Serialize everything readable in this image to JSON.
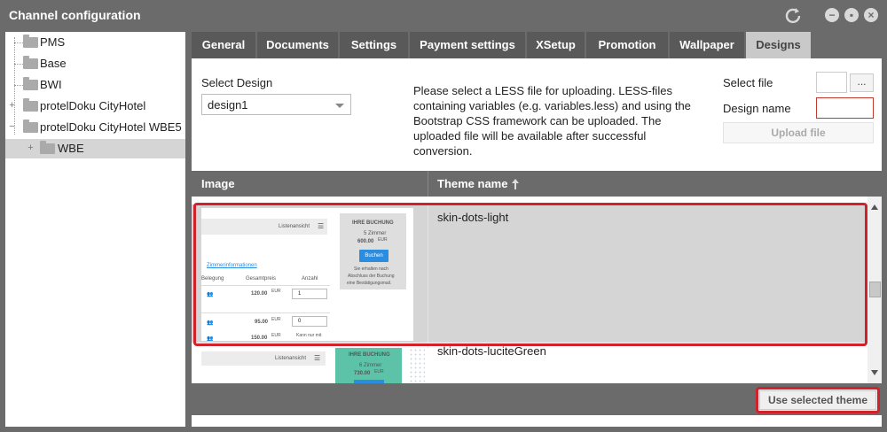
{
  "window": {
    "title": "Channel configuration",
    "icons": [
      "refresh-icon",
      "minimize-icon",
      "maximize-icon",
      "close-icon"
    ]
  },
  "tree": {
    "items": [
      {
        "label": "PMS"
      },
      {
        "label": "Base"
      },
      {
        "label": "BWI"
      },
      {
        "label": "protelDoku CityHotel"
      },
      {
        "label": "protelDoku CityHotel WBE5"
      },
      {
        "label": "WBE"
      }
    ]
  },
  "tabs": [
    {
      "label": "General"
    },
    {
      "label": "Documents"
    },
    {
      "label": "Settings"
    },
    {
      "label": "Payment settings"
    },
    {
      "label": "XSetup"
    },
    {
      "label": "Promotion"
    },
    {
      "label": "Wallpaper"
    },
    {
      "label": "Designs"
    }
  ],
  "designs": {
    "select_design_label": "Select Design",
    "select_design_value": "design1",
    "info_text": "Please select a LESS file for uploading. LESS-files containing variables (e.g. variables.less) and using the Bootstrap CSS framework can be uploaded. The uploaded file will be available after successful conversion.",
    "select_file_label": "Select file",
    "browse_label": "...",
    "design_name_label": "Design name",
    "upload_label": "Upload file"
  },
  "grid": {
    "columns": {
      "image": "Image",
      "theme": "Theme name",
      "sort_icon": "sort-ascending-icon"
    },
    "rows": [
      {
        "theme": "skin-dots-light",
        "preview": {
          "list_view": "Listenansicht",
          "booking_title": "IHRE BUCHUNG",
          "rooms": "5 Zimmer",
          "price": "600.00",
          "currency": "EUR",
          "book_button": "Buchen",
          "note_line1": "Sie erhalten nach",
          "note_line2": "Abschluss der Buchung",
          "note_line3": "eine Bestätigungsmail.",
          "room_info": "Zimmerinformationen",
          "col_occupancy": "Belegung",
          "col_total": "Gesamtpreis",
          "col_count": "Anzahl",
          "price1": "120.00",
          "qty1": "1",
          "price2": "95.00",
          "qty2": "0",
          "price3": "150.00",
          "note4": "Kann nur mit"
        }
      },
      {
        "theme": "skin-dots-luciteGreen",
        "preview": {
          "list_view": "Listenansicht",
          "booking_title": "IHRE BUCHUNG",
          "rooms": "6 Zimmer",
          "price": "730.00",
          "currency": "EUR"
        }
      }
    ]
  },
  "footer": {
    "use_theme_label": "Use selected theme"
  },
  "colors": {
    "chrome": "#6b6b6b",
    "tab_active": "#c9c9c9",
    "highlight": "#d1222b",
    "selection": "#d5d5d5",
    "accent_blue": "#2a8de0",
    "lucite_green": "#5cc2a8"
  }
}
